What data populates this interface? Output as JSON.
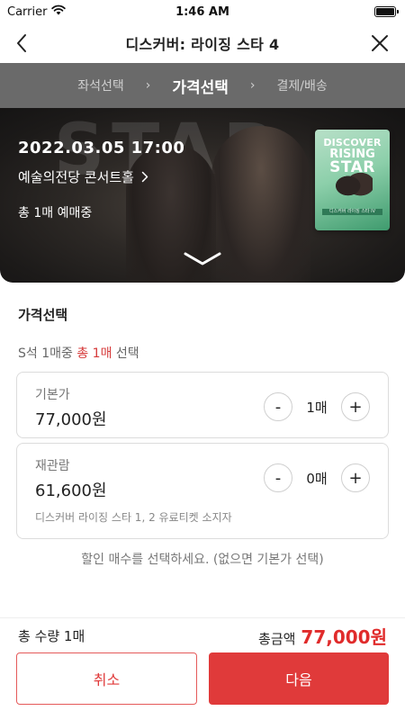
{
  "status_bar": {
    "carrier": "Carrier",
    "time": "1:46 AM"
  },
  "nav": {
    "title": "디스커버: 라이징 스타 4",
    "back_icon": "chevron-left-icon",
    "close_icon": "close-icon"
  },
  "steps": {
    "items": [
      "좌석선택",
      "가격선택",
      "결제/배송"
    ],
    "active_index": 1
  },
  "event": {
    "datetime": "2022.03.05   17:00",
    "venue": "예술의전당 콘서트홀",
    "booking_count": "총 1매 예매중",
    "background_text": "STAR",
    "poster": {
      "line1": "DISCOVER",
      "line2": "RISING",
      "line3": "STAR",
      "band": "디스커버 라이징 스타 IV"
    }
  },
  "price_section": {
    "title": "가격선택",
    "hint_prefix": "S석 1매중 ",
    "hint_highlight": "총 1매",
    "hint_suffix": " 선택",
    "options": [
      {
        "label": "기본가",
        "price": "77,000원",
        "quantity": "1매",
        "note": ""
      },
      {
        "label": "재관람",
        "price": "61,600원",
        "quantity": "0매",
        "note": "디스커버 라이징 스타 1, 2 유료티켓 소지자"
      }
    ],
    "minus_symbol": "-",
    "plus_symbol": "+",
    "notice": "할인 매수를 선택하세요. (없으면 기본가 선택)"
  },
  "footer": {
    "total_quantity": "총 수량 1매",
    "total_label": "총금액",
    "total_amount": "77,000원",
    "cancel_label": "취소",
    "next_label": "다음"
  },
  "colors": {
    "accent": "#e03a3a",
    "step_bar": "#6a6a6a"
  }
}
